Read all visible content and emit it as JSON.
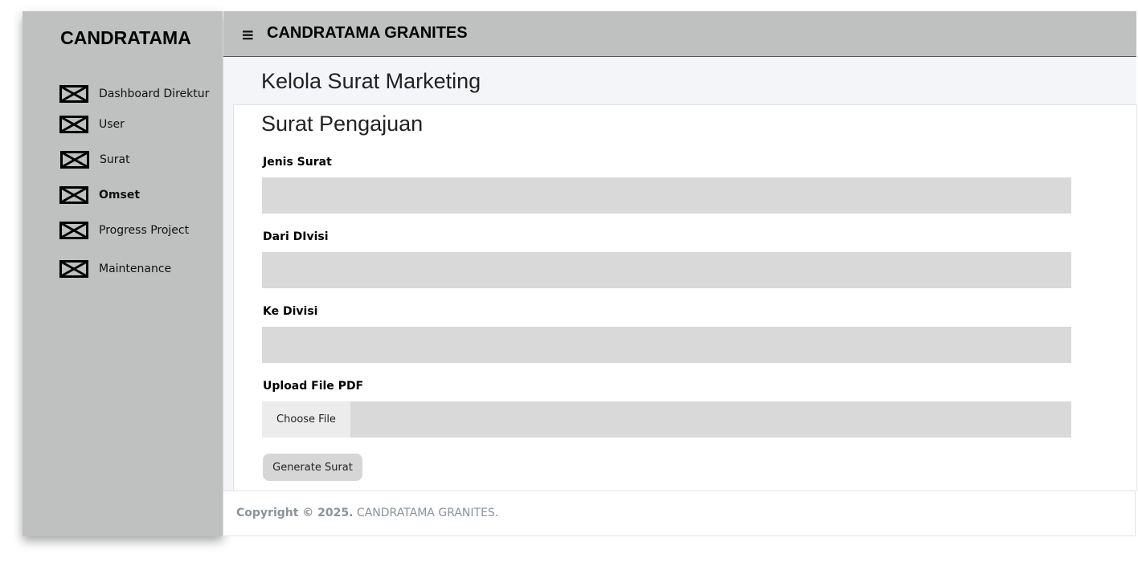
{
  "sidebar": {
    "brand": "CANDRATAMA",
    "items": [
      {
        "label": "Dashboard Direktur",
        "icon": "placeholder-icon"
      },
      {
        "label": "User",
        "icon": "placeholder-icon"
      },
      {
        "label": "Surat",
        "icon": "placeholder-icon"
      },
      {
        "label": "Omset",
        "icon": "placeholder-icon",
        "active": true
      },
      {
        "label": "Progress Project",
        "icon": "placeholder-icon"
      },
      {
        "label": "Maintenance",
        "icon": "placeholder-icon"
      }
    ]
  },
  "header": {
    "menu_icon": "≡",
    "title": "CANDRATAMA GRANITES"
  },
  "page": {
    "title": "Kelola Surat Marketing"
  },
  "form": {
    "title": "Surat Pengajuan",
    "jenis_label": "Jenis Surat",
    "jenis_value": "",
    "dari_label": "Dari DIvisi",
    "dari_value": "",
    "ke_label": "Ke Divisi",
    "ke_value": "",
    "upload_label": "Upload File PDF",
    "choose_file": "Choose File",
    "submit": "Generate Surat"
  },
  "footer": {
    "copyright": "Copyright © 2025.",
    "company": "CANDRATAMA GRANITES."
  },
  "colors": {
    "sidebar_bg": "#bfc1c0",
    "header_bg": "#bfc1c0",
    "input_bg": "#d9d9d9",
    "content_bg": "#f4f5f8"
  }
}
